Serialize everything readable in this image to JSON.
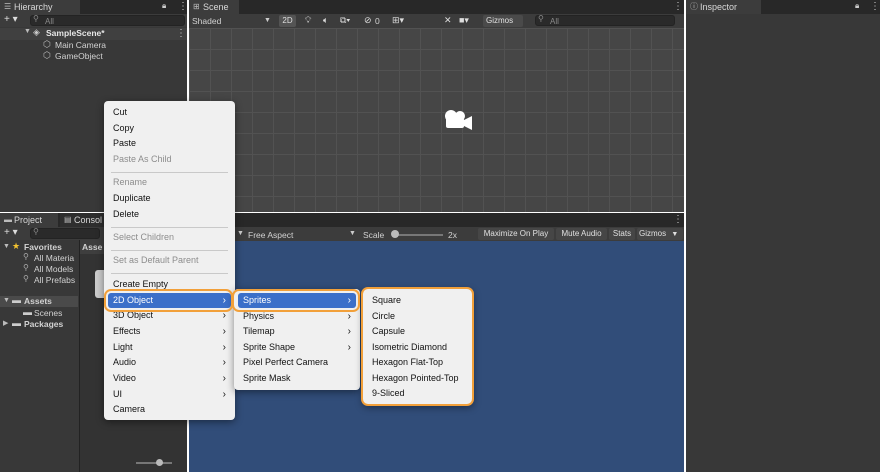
{
  "hierarchy": {
    "tab": "Hierarchy",
    "search_placeholder": "All",
    "add": "+ ▾",
    "scene": "SampleScene*",
    "items": [
      "Main Camera",
      "GameObject"
    ]
  },
  "scene": {
    "tab": "Scene",
    "shading": "Shaded",
    "mode2d": "2D",
    "hidden_count": "0",
    "gizmos": "Gizmos",
    "search_placeholder": "All"
  },
  "inspector": {
    "tab": "Inspector"
  },
  "game": {
    "aspect": "Free Aspect",
    "scale_label": "Scale",
    "scale_value": "2x",
    "maximize": "Maximize On Play",
    "mute": "Mute Audio",
    "stats": "Stats",
    "gizmos": "Gizmos"
  },
  "project": {
    "tabs": [
      "Project",
      "Consol"
    ],
    "favorites": "Favorites",
    "fav_items": [
      "All Materia",
      "All Models",
      "All Prefabs"
    ],
    "assets": "Assets",
    "asset_items": [
      "Scenes"
    ],
    "packages": "Packages",
    "assets_header": "Asse"
  },
  "context_menu": {
    "items": [
      "Cut",
      "Copy",
      "Paste",
      "Paste As Child",
      "Rename",
      "Duplicate",
      "Delete",
      "Select Children",
      "Set as Default Parent",
      "Create Empty",
      "2D Object",
      "3D Object",
      "Effects",
      "Light",
      "Audio",
      "Video",
      "UI",
      "Camera"
    ]
  },
  "submenu_2d": {
    "items": [
      "Sprites",
      "Physics",
      "Tilemap",
      "Sprite Shape",
      "Pixel Perfect Camera",
      "Sprite Mask"
    ]
  },
  "submenu_sprites": {
    "items": [
      "Square",
      "Circle",
      "Capsule",
      "Isometric Diamond",
      "Hexagon Flat-Top",
      "Hexagon Pointed-Top",
      "9-Sliced"
    ]
  },
  "colors": {
    "accent": "#f2a03a",
    "selection": "#3b6fc9",
    "game_bg": "#314d79",
    "panel": "#383838"
  }
}
